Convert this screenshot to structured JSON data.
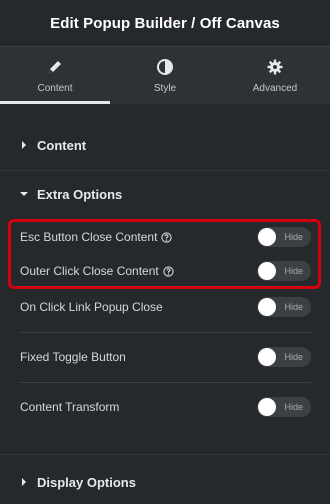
{
  "header": {
    "title": "Edit Popup Builder / Off Canvas"
  },
  "tabs": [
    {
      "label": "Content",
      "icon": "pencil-icon",
      "active": true
    },
    {
      "label": "Style",
      "icon": "half-circle-icon",
      "active": false
    },
    {
      "label": "Advanced",
      "icon": "gear-icon",
      "active": false
    }
  ],
  "sections": {
    "content": {
      "title": "Content",
      "expanded": false
    },
    "extra_options": {
      "title": "Extra Options",
      "expanded": true
    },
    "display_options": {
      "title": "Display Options",
      "expanded": false
    }
  },
  "extra_options": {
    "rows": [
      {
        "label": "Esc Button Close Content",
        "toggle": "Hide",
        "help": true
      },
      {
        "label": "Outer Click Close Content",
        "toggle": "Hide",
        "help": true
      },
      {
        "label": "On Click Link Popup Close",
        "toggle": "Hide",
        "help": false
      },
      {
        "label": "Fixed Toggle Button",
        "toggle": "Hide",
        "help": false
      },
      {
        "label": "Content Transform",
        "toggle": "Hide",
        "help": false
      }
    ]
  },
  "colors": {
    "highlight": "#d40010",
    "panel_bg": "#26292c",
    "tabs_bg": "#2f3235"
  }
}
